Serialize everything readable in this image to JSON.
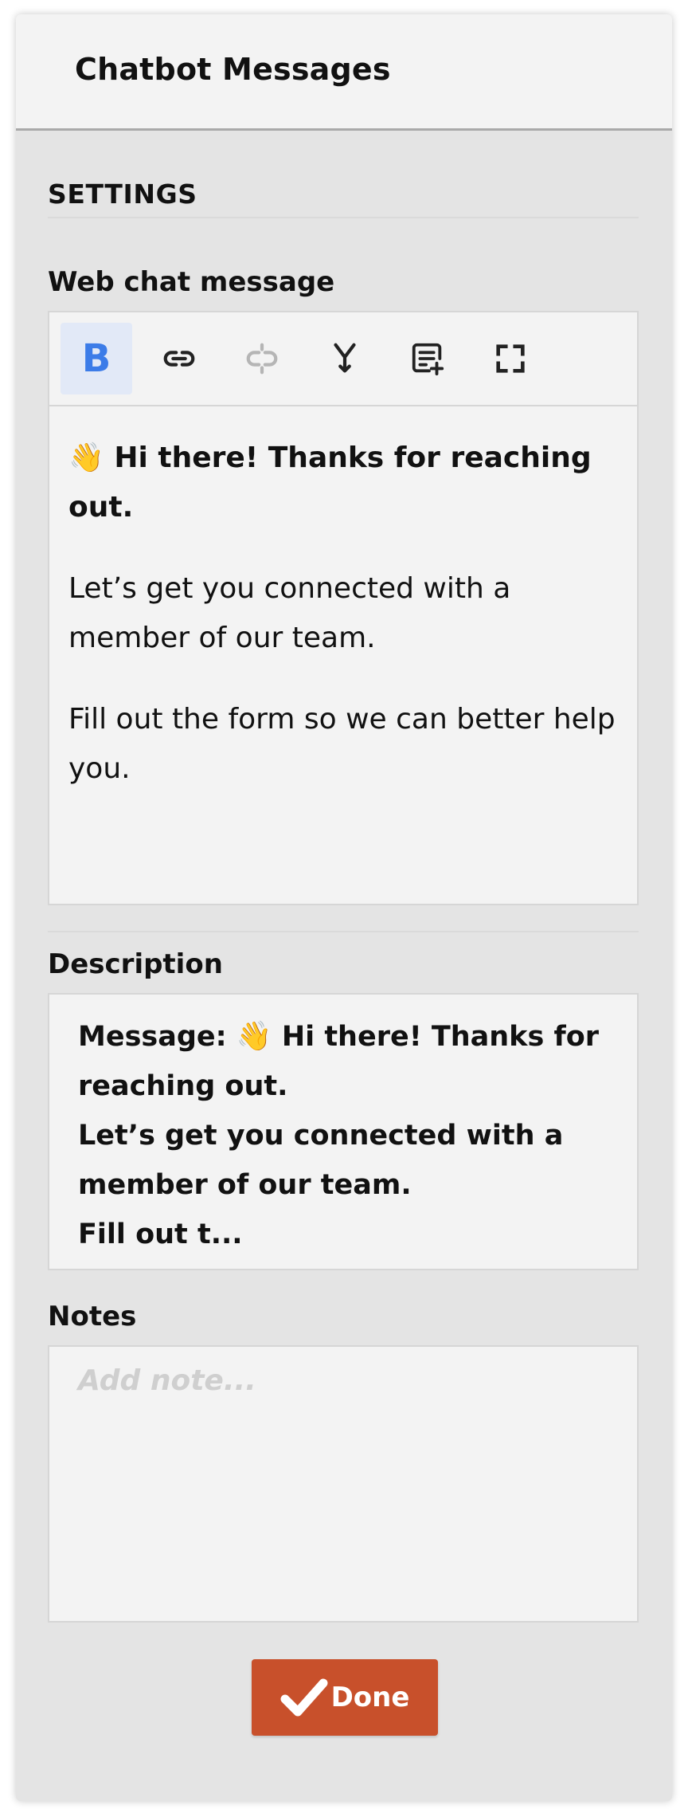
{
  "header": {
    "title": "Chatbot Messages"
  },
  "settings": {
    "heading": "SETTINGS"
  },
  "web_chat": {
    "label": "Web chat message",
    "toolbar": {
      "bold_label": "B",
      "icons": [
        "bold-icon",
        "link-icon",
        "unlink-icon",
        "merge-icon",
        "insert-snippet-icon",
        "fullscreen-icon"
      ]
    },
    "message": {
      "emoji": "👋",
      "line1": "Hi there! Thanks for reaching out.",
      "line2": "Let’s get you connected with a member of our team.",
      "line3": "Fill out the form so we can better help you."
    }
  },
  "description": {
    "label": "Description",
    "line1_prefix": "Message: ",
    "emoji": "👋",
    "line1_rest": " Hi there! Thanks for reaching out.",
    "line2": "Let’s get you connected with a member of our team.",
    "line3": "Fill out t..."
  },
  "notes": {
    "label": "Notes",
    "placeholder": "Add note...",
    "value": ""
  },
  "done_button": {
    "label": "Done",
    "color": "#c8502b"
  },
  "colors": {
    "accent": "#3c7ce8",
    "panel_bg": "#e4e4e4",
    "header_bg": "#f3f3f3"
  }
}
